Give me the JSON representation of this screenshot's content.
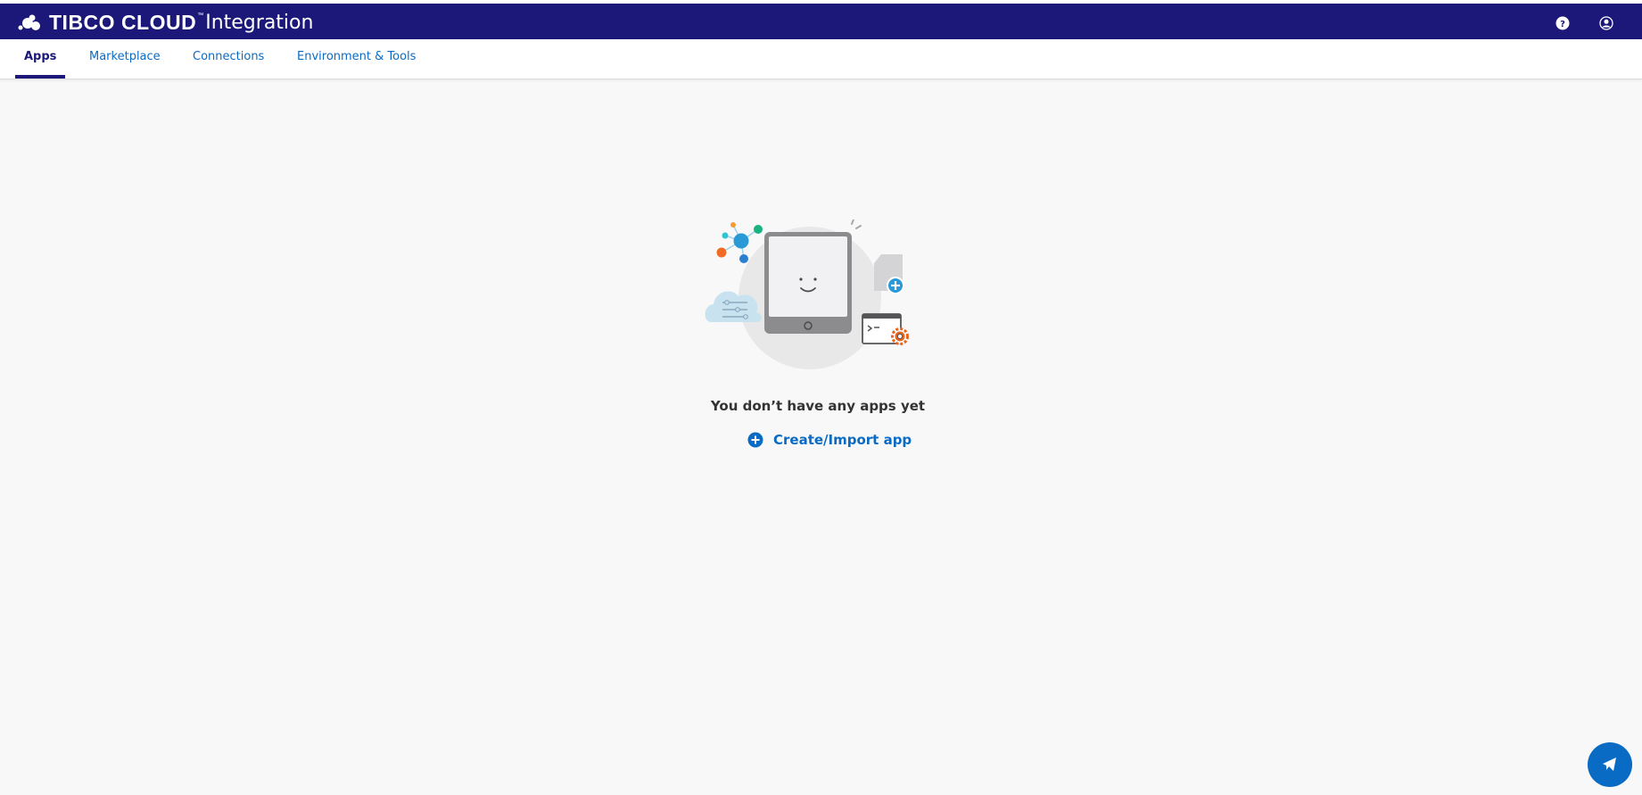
{
  "header": {
    "brand_main": "TIBCO CLOUD",
    "brand_tm": "™",
    "brand_product": "Integration",
    "help_icon": "help-icon",
    "user_icon": "user-icon",
    "background_color": "#1b1879"
  },
  "tabs": [
    {
      "label": "Apps",
      "active": true
    },
    {
      "label": "Marketplace",
      "active": false
    },
    {
      "label": "Connections",
      "active": false
    },
    {
      "label": "Environment & Tools",
      "active": false
    }
  ],
  "main": {
    "empty_message": "You don’t have any apps yet",
    "create_label": "Create/Import app",
    "create_icon": "plus-circle-icon",
    "illustration": "empty-apps-illustration"
  },
  "feedback": {
    "icon": "feedback-megaphone-icon"
  },
  "colors": {
    "accent": "#0a6bc4",
    "brand": "#1b1879",
    "background": "#f8f8f8"
  }
}
